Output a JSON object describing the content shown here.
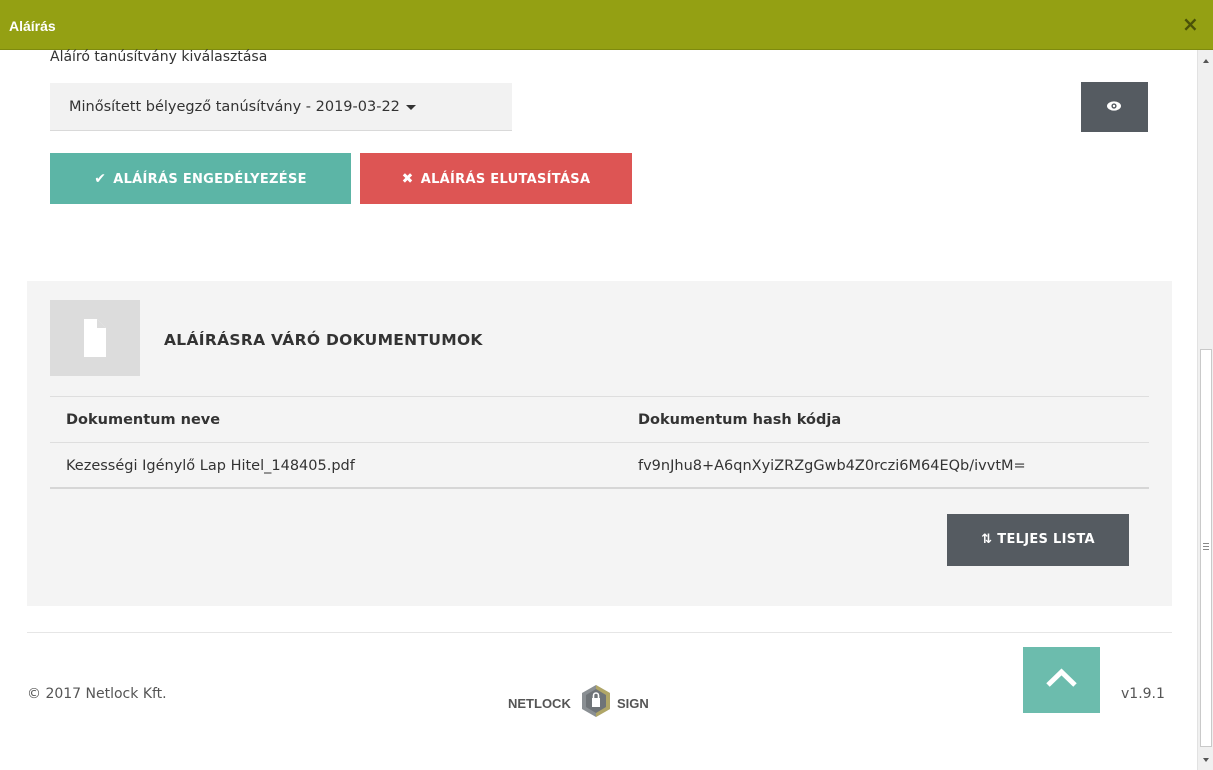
{
  "dialog": {
    "title": "Aláírás",
    "close_icon": "×"
  },
  "signer": {
    "label": "Aláíró tanúsítvány kiválasztása",
    "selected_certificate": "Minősített bélyegző tanúsítvány - 2019-03-22",
    "preview_icon": "eye-icon"
  },
  "actions": {
    "approve_label": "ALÁÍRÁS ENGEDÉLYEZÉSE",
    "approve_icon": "✔",
    "reject_label": "ALÁÍRÁS ELUTASÍTÁSA",
    "reject_icon": "✖"
  },
  "documents": {
    "heading": "ALÁÍRÁSRA VÁRÓ DOKUMENTUMOK",
    "columns": [
      "Dokumentum neve",
      "Dokumentum hash kódja"
    ],
    "rows": [
      {
        "name": "Kezességi Igénylő Lap Hitel_148405.pdf",
        "hash": "fv9nJhu8+A6qnXyiZRZgGwb4Z0rczi6M64EQb/ivvtM="
      }
    ],
    "full_list_label": "TELJES LISTA",
    "full_list_icon": "sort-icon"
  },
  "footer": {
    "copyright": "© 2017 Netlock Kft.",
    "logo_left": "NETLOCK",
    "logo_right": "SIGN",
    "version": "v1.9.1"
  },
  "colors": {
    "titlebar": "#94a013",
    "approve": "#5cb5a6",
    "reject": "#dd5554",
    "dark_button": "#555b61",
    "scroll_top": "#6cbcad"
  }
}
